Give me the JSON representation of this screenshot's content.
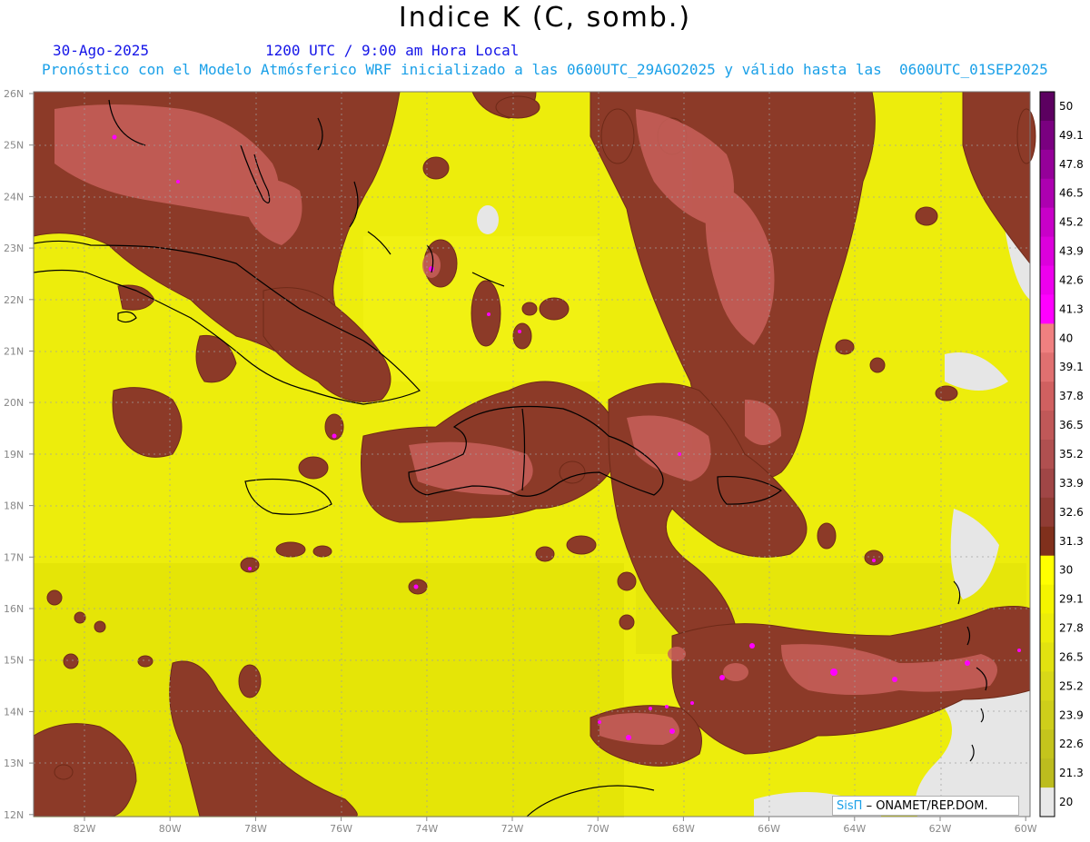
{
  "title": "Indice K (C, somb.)",
  "date": "30-Ago-2025",
  "time": "1200 UTC / 9:00 am Hora Local",
  "forecast": "Pronóstico con el Modelo Atmósferico WRF inicializado a las 0600UTC_29AGO2025 y válido hasta las  0600UTC_01SEP2025",
  "credit": {
    "brand": "SisΠ",
    "org": "– ONAMET/REP.DOM."
  },
  "axes": {
    "lat_labels": [
      "26N",
      "25N",
      "24N",
      "23N",
      "22N",
      "21N",
      "20N",
      "19N",
      "18N",
      "17N",
      "16N",
      "15N",
      "14N",
      "13N",
      "12N"
    ],
    "lon_labels": [
      "82W",
      "80W",
      "78W",
      "76W",
      "74W",
      "72W",
      "70W",
      "68W",
      "66W",
      "64W",
      "62W",
      "60W"
    ]
  },
  "colorbar": {
    "labels": [
      "50",
      "49.1",
      "47.8",
      "46.5",
      "45.2",
      "43.9",
      "42.6",
      "41.3",
      "40",
      "39.1",
      "37.8",
      "36.5",
      "35.2",
      "33.9",
      "32.6",
      "31.3",
      "30",
      "29.1",
      "27.8",
      "26.5",
      "25.2",
      "23.9",
      "22.6",
      "21.3",
      "20"
    ],
    "colors": [
      "#5c0060",
      "#7a0080",
      "#950099",
      "#ad00b0",
      "#c800c8",
      "#dc00dc",
      "#ee00ee",
      "#ff00ff",
      "#f08080",
      "#e07070",
      "#d06060",
      "#c05858",
      "#b05050",
      "#a04646",
      "#903c34",
      "#80301c",
      "#ffff00",
      "#f4f400",
      "#ecec0a",
      "#e2e210",
      "#d8d818",
      "#cece1a",
      "#c4c41c",
      "#bcbc1e",
      "#e8e8e8"
    ]
  },
  "colors": {
    "yellow": "#f0f000",
    "brown": "#8c3a28",
    "salmon": "#d46a60",
    "magenta": "#ff00ff",
    "grey": "#e8e8e8",
    "coast": "#000000"
  }
}
